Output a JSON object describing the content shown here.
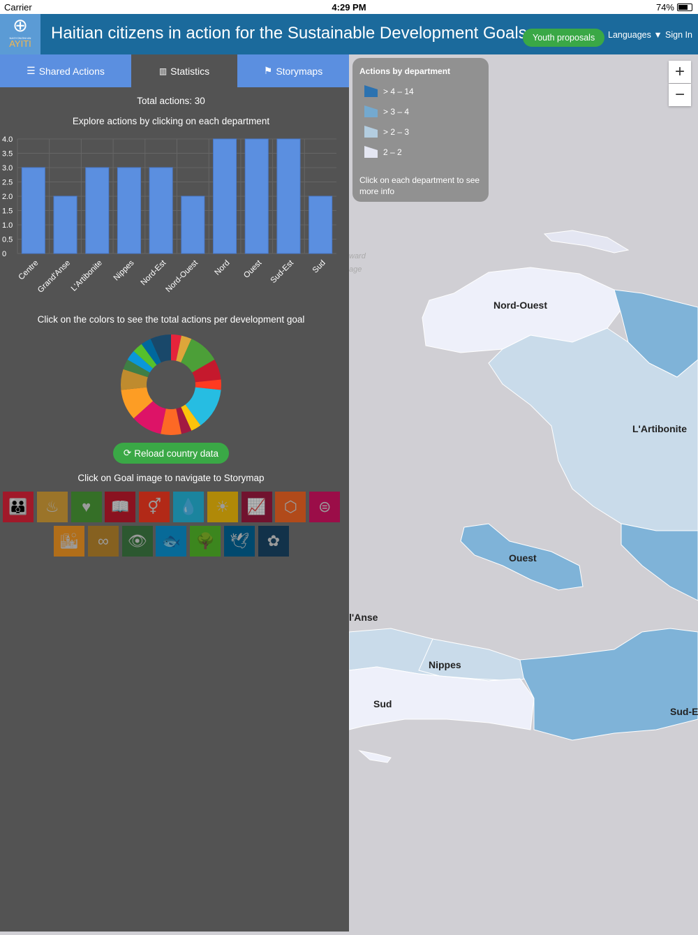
{
  "status": {
    "carrier": "Carrier",
    "time": "4:29 PM",
    "battery": "74%"
  },
  "header": {
    "logo_top": "NASYONZINI AN",
    "logo_bottom": "AYITI",
    "title": "Haitian citizens in action for the Sustainable Development Goals",
    "youth_button": "Youth proposals",
    "languages": "Languages ▼",
    "sign_in": "Sign In"
  },
  "tabs": [
    {
      "label": "Shared Actions",
      "icon": "list-icon"
    },
    {
      "label": "Statistics",
      "icon": "bar-chart-icon"
    },
    {
      "label": "Storymaps",
      "icon": "signpost-icon"
    }
  ],
  "stats": {
    "total": "Total actions: 30",
    "explore": "Explore actions by clicking on each department",
    "goals_hint": "Click on the colors to see the total actions per development goal",
    "reload": "Reload country data",
    "goal_nav": "Click on Goal image to navigate to Storymap"
  },
  "chart_data": [
    {
      "type": "bar",
      "title": "Actions by department",
      "categories": [
        "Centre",
        "Grand'Anse",
        "L'Artibonite",
        "Nippes",
        "Nord-Est",
        "Nord-Ouest",
        "Nord",
        "Ouest",
        "Sud-Est",
        "Sud"
      ],
      "values": [
        3,
        2,
        3,
        3,
        3,
        2,
        4,
        4,
        4,
        2
      ],
      "ylim": [
        0,
        4
      ],
      "yticks": [
        "0",
        "0.5",
        "1.0",
        "1.5",
        "2.0",
        "2.5",
        "3.0",
        "3.5",
        "4.0"
      ],
      "color": "#5b8fe0"
    },
    {
      "type": "pie",
      "title": "Actions per development goal",
      "labels": [
        "SDG1",
        "SDG2",
        "SDG3",
        "SDG4",
        "SDG5",
        "SDG6",
        "SDG7",
        "SDG8",
        "SDG9",
        "SDG10",
        "SDG11",
        "SDG12",
        "SDG13",
        "SDG14",
        "SDG15",
        "SDG16",
        "SDG17"
      ],
      "values": [
        2,
        2,
        6,
        4,
        2,
        8,
        2,
        2,
        4,
        6,
        6,
        4,
        2,
        2,
        2,
        2,
        4
      ],
      "colors": [
        "#e5243b",
        "#dda63a",
        "#4c9f38",
        "#c5192d",
        "#ff3a21",
        "#26bde2",
        "#fcc30b",
        "#a21942",
        "#fd6925",
        "#dd1367",
        "#fd9d24",
        "#bf8b2e",
        "#3f7e44",
        "#0a97d9",
        "#56c02b",
        "#00689d",
        "#19486a"
      ]
    }
  ],
  "goals": [
    {
      "color": "#e5243b",
      "glyph": "👪"
    },
    {
      "color": "#dda63a",
      "glyph": "♨"
    },
    {
      "color": "#4c9f38",
      "glyph": "♥"
    },
    {
      "color": "#c5192d",
      "glyph": "📖"
    },
    {
      "color": "#ff3a21",
      "glyph": "⚥"
    },
    {
      "color": "#26bde2",
      "glyph": "💧"
    },
    {
      "color": "#fcc30b",
      "glyph": "☀"
    },
    {
      "color": "#a21942",
      "glyph": "📈"
    },
    {
      "color": "#fd6925",
      "glyph": "⬡"
    },
    {
      "color": "#dd1367",
      "glyph": "⊜"
    },
    {
      "color": "#fd9d24",
      "glyph": "🏙"
    },
    {
      "color": "#bf8b2e",
      "glyph": "∞"
    },
    {
      "color": "#3f7e44",
      "glyph": "👁"
    },
    {
      "color": "#0a97d9",
      "glyph": "🐟"
    },
    {
      "color": "#56c02b",
      "glyph": "🌳"
    },
    {
      "color": "#00689d",
      "glyph": "🕊"
    },
    {
      "color": "#19486a",
      "glyph": "✿"
    }
  ],
  "legend": {
    "title": "Actions by department",
    "items": [
      {
        "label": "> 4 – 14",
        "color": "#2c72b0"
      },
      {
        "label": "> 3 – 4",
        "color": "#74a9cf"
      },
      {
        "label": "> 2 – 3",
        "color": "#b3cde0"
      },
      {
        "label": "2 – 2",
        "color": "#e4e6f2"
      }
    ],
    "hint": "Click on each department to see more info"
  },
  "map": {
    "zoom_in": "+",
    "zoom_out": "−",
    "labels": {
      "nord_ouest": "Nord-Ouest",
      "artibonite": "L'Artibonite",
      "ouest": "Ouest",
      "grandanse": "l'Anse",
      "nippes": "Nippes",
      "sud": "Sud",
      "sudest": "Sud-E"
    },
    "base_labels": [
      "ward",
      "age"
    ]
  }
}
